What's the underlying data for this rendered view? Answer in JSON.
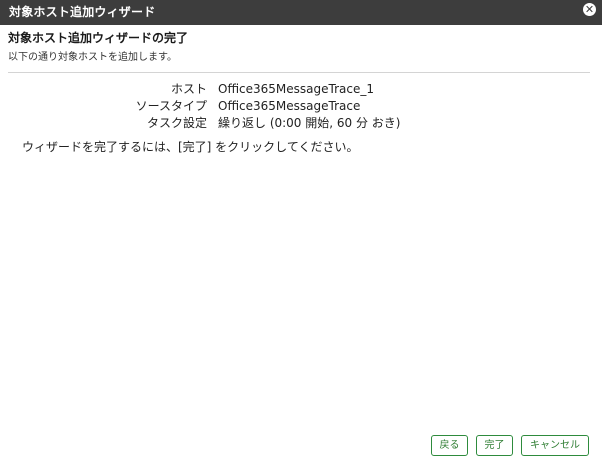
{
  "window": {
    "title": "対象ホスト追加ウィザード",
    "close_glyph": "✕"
  },
  "main": {
    "heading": "対象ホスト追加ウィザードの完了",
    "subheading": "以下の通り対象ホストを追加します。",
    "summary": [
      {
        "label": "ホスト",
        "value": "Office365MessageTrace_1"
      },
      {
        "label": "ソースタイプ",
        "value": "Office365MessageTrace"
      },
      {
        "label": "タスク設定",
        "value": "繰り返し (0:00 開始, 60 分 おき)"
      }
    ],
    "instruction": "ウィザードを完了するには、[完了] をクリックしてください。"
  },
  "footer": {
    "back_label": "戻る",
    "finish_label": "完了",
    "cancel_label": "キャンセル"
  },
  "colors": {
    "titlebar": "#3d3d3d",
    "button_border": "#2e8b3d"
  },
  "icons": {
    "close": "close-icon"
  }
}
